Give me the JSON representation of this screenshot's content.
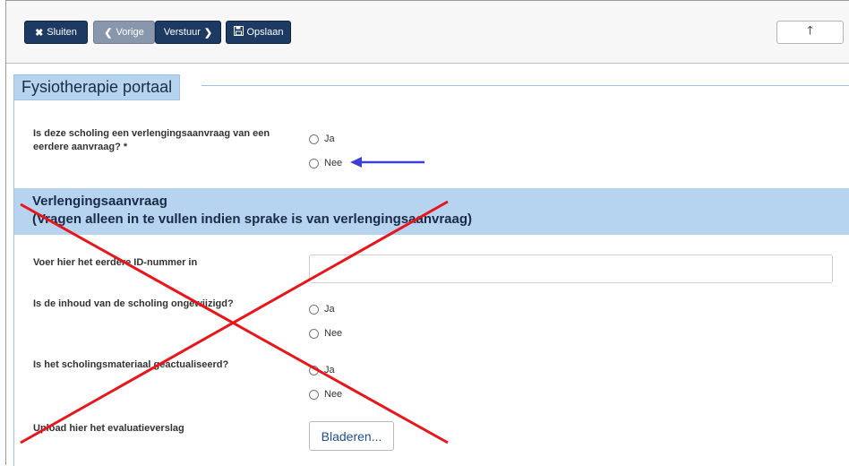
{
  "toolbar": {
    "close_label": "Sluiten",
    "prev_label": "Vorige",
    "send_label": "Verstuur",
    "save_label": "Opslaan",
    "up_label": "🡑"
  },
  "portal": {
    "title": "Fysiotherapie portaal"
  },
  "q1": {
    "label": "Is deze scholing een verlengingsaanvraag van een eerdere aanvraag? *",
    "option_yes": "Ja",
    "option_no": "Nee"
  },
  "section": {
    "title": "Verlengingsaanvraag",
    "subtitle": "(Vragen alleen in te vullen indien sprake is van verlengingsaanvraag)"
  },
  "q2": {
    "label": "Voer hier het eerdere ID-nummer in",
    "value": ""
  },
  "q3": {
    "label": "Is de inhoud van de scholing ongewijzigd?",
    "option_yes": "Ja",
    "option_no": "Nee"
  },
  "q4": {
    "label": "Is het scholingsmateriaal geactualiseerd?",
    "option_yes": "Ja",
    "option_no": "Nee"
  },
  "q5": {
    "label": "Upload hier het evaluatieverslag",
    "button_label": "Bladeren..."
  },
  "colors": {
    "toolbar_button": "#1d3a63",
    "section_bg": "#b6d3ef",
    "annotation_cross": "#e8151b",
    "annotation_arrow": "#3b3fd6"
  }
}
